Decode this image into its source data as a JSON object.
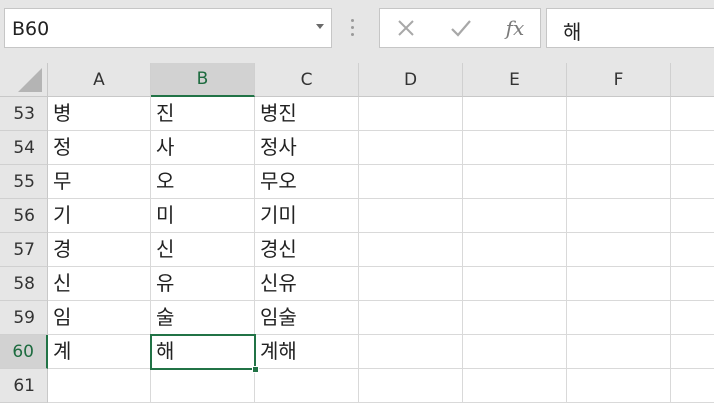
{
  "name_box": {
    "value": "B60"
  },
  "formula_bar": {
    "cancel_icon": "close-icon",
    "enter_icon": "check-icon",
    "fx_label": "fx",
    "value": "해"
  },
  "columns": [
    "A",
    "B",
    "C",
    "D",
    "E",
    "F"
  ],
  "active_column": "B",
  "rows": [
    {
      "num": "53",
      "cells": [
        "병",
        "진",
        "병진",
        "",
        "",
        ""
      ]
    },
    {
      "num": "54",
      "cells": [
        "정",
        "사",
        "정사",
        "",
        "",
        ""
      ]
    },
    {
      "num": "55",
      "cells": [
        "무",
        "오",
        "무오",
        "",
        "",
        ""
      ]
    },
    {
      "num": "56",
      "cells": [
        "기",
        "미",
        "기미",
        "",
        "",
        ""
      ]
    },
    {
      "num": "57",
      "cells": [
        "경",
        "신",
        "경신",
        "",
        "",
        ""
      ]
    },
    {
      "num": "58",
      "cells": [
        "신",
        "유",
        "신유",
        "",
        "",
        ""
      ]
    },
    {
      "num": "59",
      "cells": [
        "임",
        "술",
        "임술",
        "",
        "",
        ""
      ]
    },
    {
      "num": "60",
      "cells": [
        "계",
        "해",
        "계해",
        "",
        "",
        ""
      ]
    },
    {
      "num": "61",
      "cells": [
        "",
        "",
        "",
        "",
        "",
        ""
      ]
    }
  ],
  "active_cell": {
    "column": "B",
    "row": "60"
  },
  "colors": {
    "accent": "#217346",
    "header_bg": "#e6e6e6",
    "active_header_bg": "#d2d2d2",
    "gridline": "#d9d9d9"
  }
}
